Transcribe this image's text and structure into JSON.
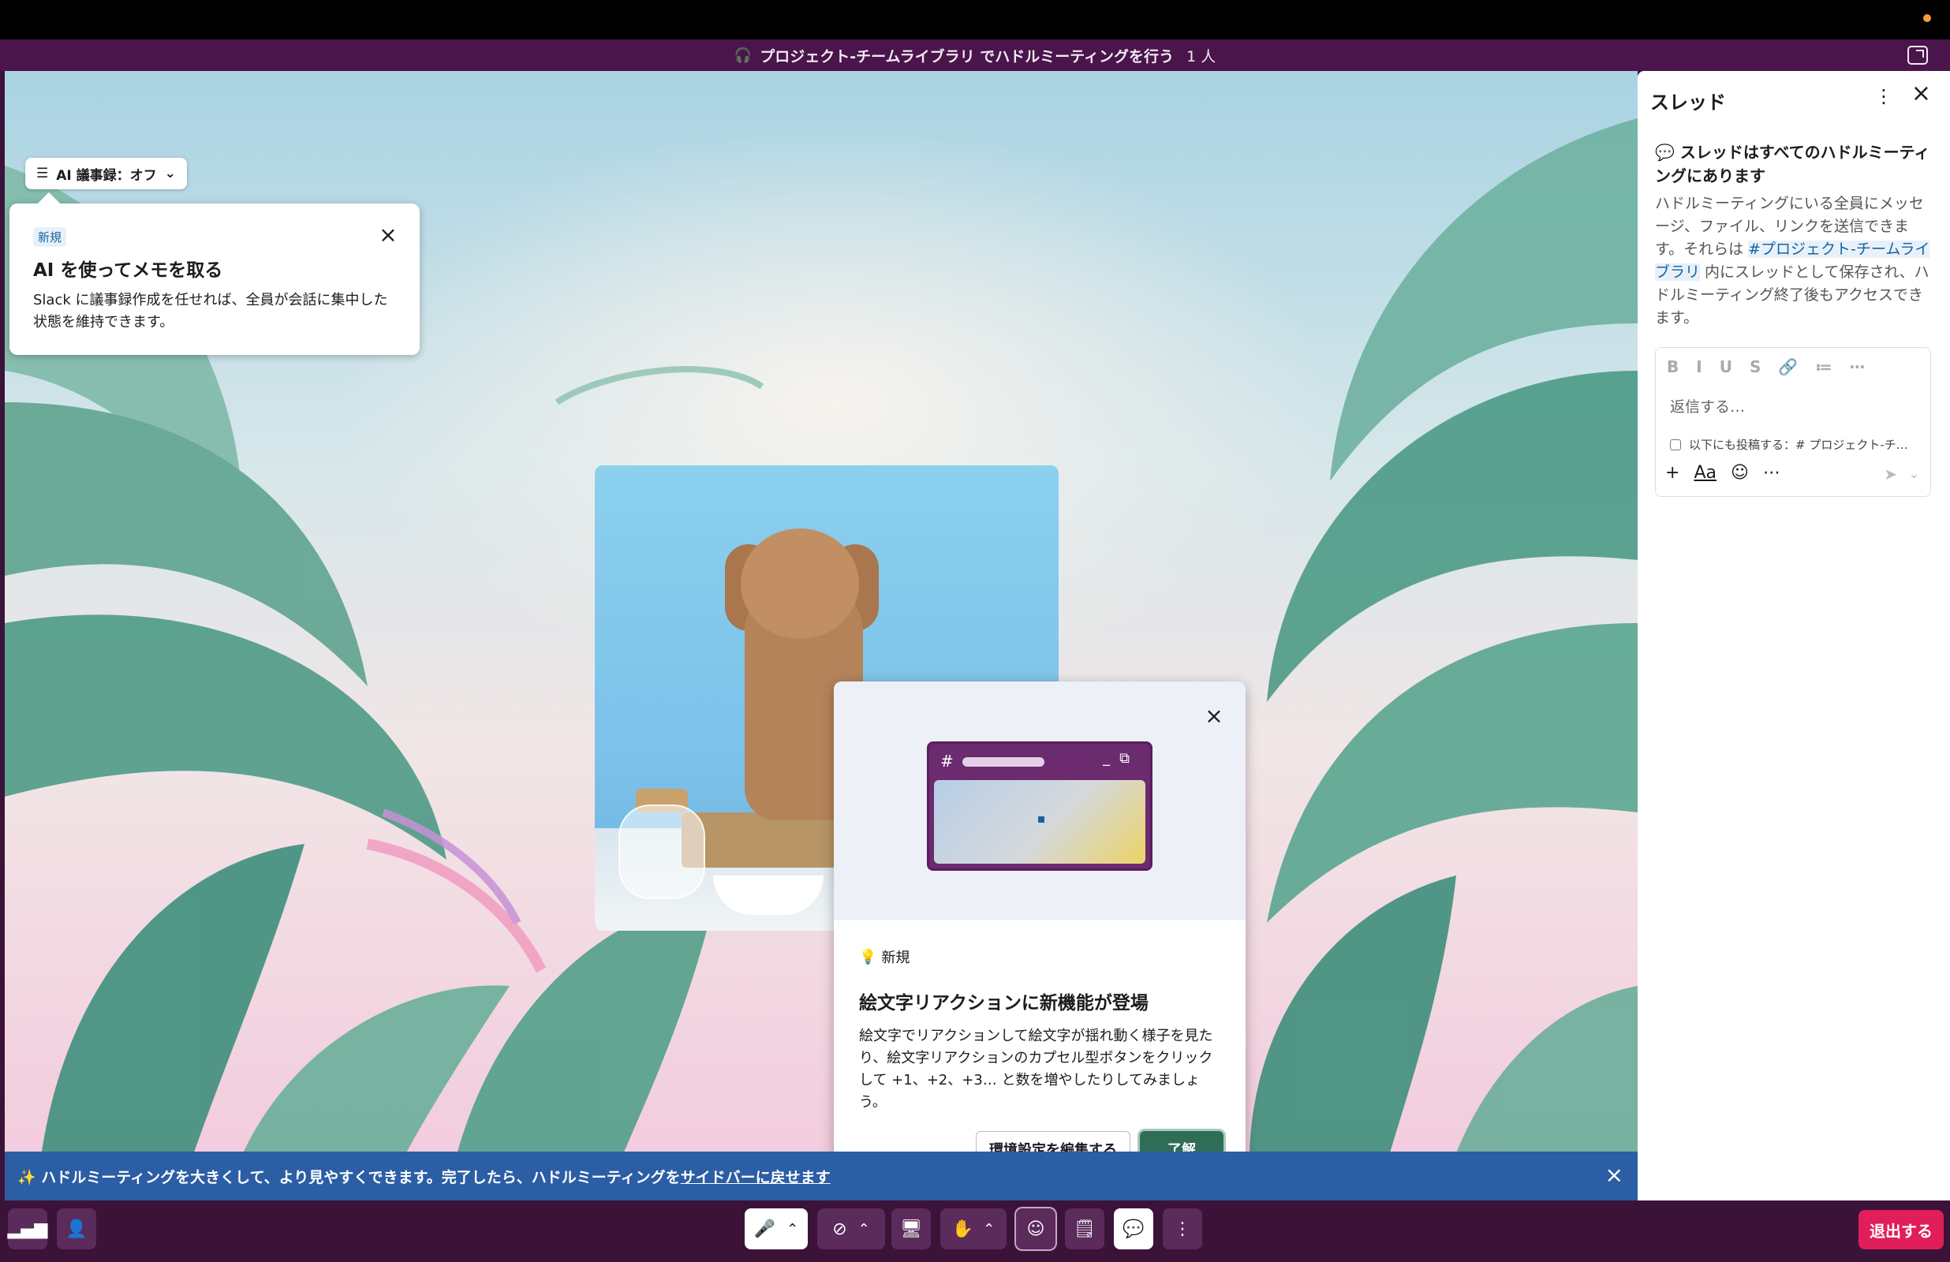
{
  "titlebar": {
    "icon": "headphones-icon",
    "title": "プロジェクト-チームライブラリ でハドルミーティングを行う",
    "count": "1 人"
  },
  "ai_notes": {
    "dropdown_label": "AI 議事録：オフ",
    "popup_badge": "新規",
    "popup_title": "AI を使ってメモを取る",
    "popup_text": "Slack に議事録作成を任せれば、全員が会話に集中した状態を維持できます。"
  },
  "emoji_popup": {
    "window_hash": "#",
    "badge": "新規",
    "title": "絵文字リアクションに新機能が登場",
    "text": "絵文字でリアクションして絵文字が揺れ動く様子を見たり、絵文字リアクションのカプセル型ボタンをクリックして +1、+2、+3… と数を増やしたりしてみましょう。",
    "secondary_button": "環境設定を編集する",
    "primary_button": "了解"
  },
  "banner": {
    "prefix": "✨ ハドルミーティングを大きくして、より見やすくできます。完了したら、ハドルミーティングを",
    "link": "サイドバーに戻せます"
  },
  "thread_panel": {
    "title": "スレッド",
    "info_title": "スレッドはすべてのハドルミーティングにあります",
    "info_text_1": "ハドルミーティングにいる全員にメッセージ、ファイル、リンクを送信できます。それらは ",
    "info_channel": "#プロジェクト-チームライブラリ",
    "info_text_2": " 内にスレッドとして保存され、ハドルミーティング終了後もアクセスできます。",
    "composer_placeholder": "返信する…",
    "also_send": "以下にも投稿する：# プロジェクト-チ…",
    "format_buttons": [
      "B",
      "I",
      "U",
      "S",
      "🔗",
      "≔",
      "⋯"
    ]
  },
  "bottombar": {
    "leave_label": "退出する"
  },
  "colors": {
    "aubergine": "#4a154b",
    "banner_blue": "#2b5ea5",
    "leave_red": "#e01e5a",
    "confirm_green": "#2f6e55"
  }
}
